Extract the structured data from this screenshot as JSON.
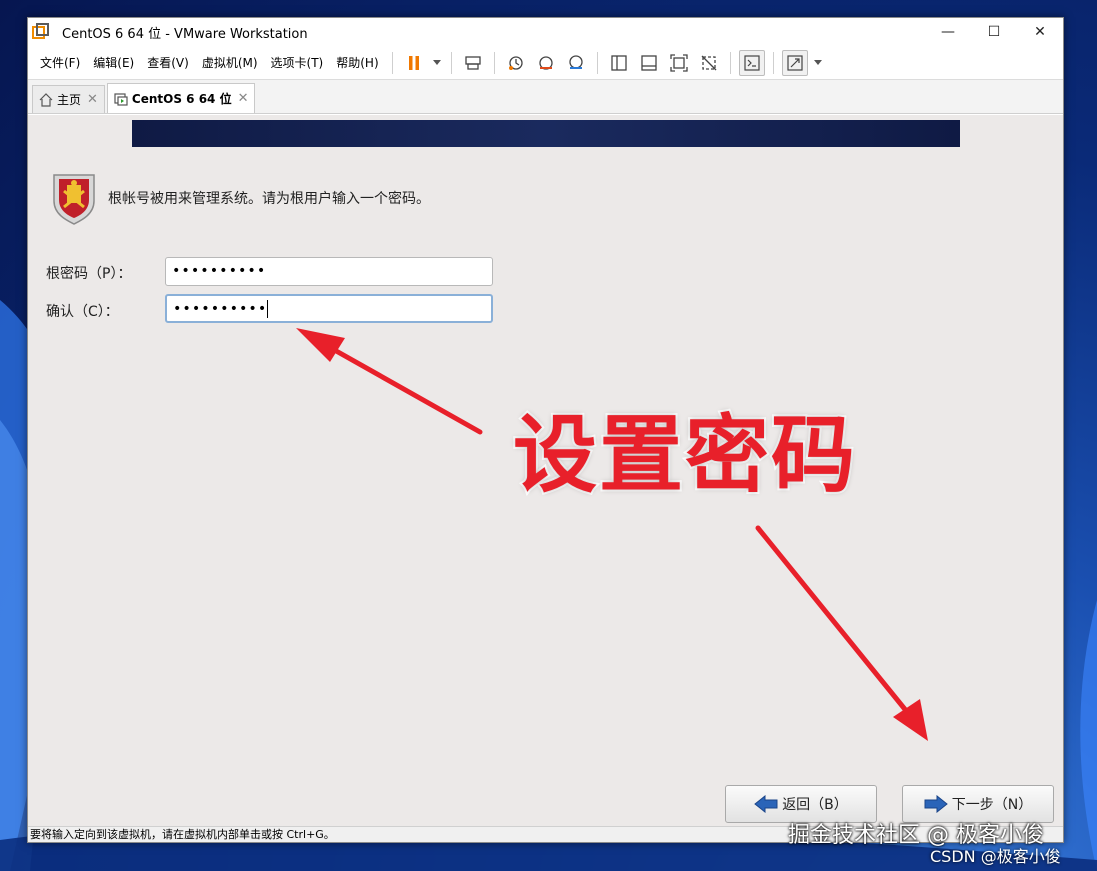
{
  "window": {
    "title": "CentOS 6 64 位 - VMware Workstation",
    "minimize": "—",
    "maximize": "☐",
    "close": "✕"
  },
  "menu": [
    {
      "label": "文件(F)"
    },
    {
      "label": "编辑(E)"
    },
    {
      "label": "查看(V)"
    },
    {
      "label": "虚拟机(M)"
    },
    {
      "label": "选项卡(T)"
    },
    {
      "label": "帮助(H)"
    }
  ],
  "tabs": [
    {
      "label": "主页",
      "active": false
    },
    {
      "label": "CentOS 6 64 位",
      "active": true
    }
  ],
  "installer": {
    "intro": "根帐号被用来管理系统。请为根用户输入一个密码。",
    "password_label": "根密码（P）：",
    "password_value": "••••••••••",
    "confirm_label": "确认（C）：",
    "confirm_value": "••••••••••",
    "back_button": "返回（B）",
    "next_button": "下一步（N）"
  },
  "statusbar": {
    "text": "要将输入定向到该虚拟机，请在虚拟机内部单击或按 Ctrl+G。"
  },
  "annotation": {
    "caption": "设置密码",
    "arrow_color": "#e8202a"
  },
  "watermarks": {
    "primary": "掘金技术社区 @ 极客小俊",
    "secondary": "CSDN @极客小俊"
  }
}
